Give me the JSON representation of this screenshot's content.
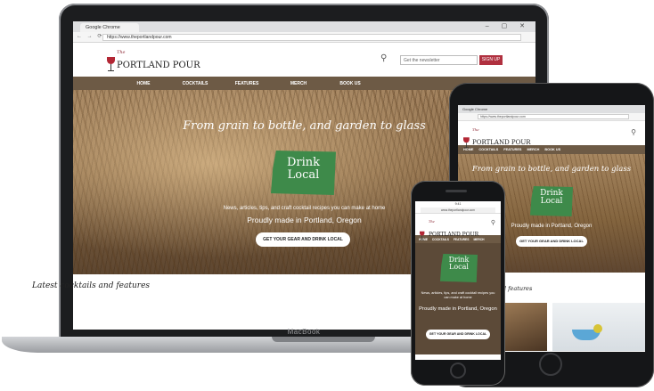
{
  "device_label": "MacBook",
  "browser": {
    "tab_title": "Google Chrome",
    "url": "https://www.theportlandpour.com",
    "window_controls": "– ▢ ✕",
    "nav_arrows": "← → ⟳"
  },
  "tablet_browser": {
    "tab_title": "Google Chrome",
    "url": "https://www.theportlandpour.com"
  },
  "phone_browser": {
    "status_time": "9:41",
    "url": "www.theportlandpour.com"
  },
  "site": {
    "logo_the": "The",
    "logo_name": "PORTLAND POUR",
    "search_icon": "⚲",
    "newsletter_placeholder": "Get the newsletter",
    "signup_label": "SIGN UP",
    "nav": [
      "HOME",
      "COCKTAILS",
      "FEATURES",
      "MERCH",
      "BOOK US"
    ],
    "hero_tagline": "From grain to bottle, and garden to glass",
    "badge_line1": "Drink",
    "badge_line2": "Local",
    "hero_sub": "News, articles, tips, and craft cocktail recipes you can make at home",
    "hero_made": "Proudly made in Portland, Oregon",
    "hero_button": "GET YOUR GEAR AND DRINK LOCAL",
    "latest_heading": "Latest cocktails and features",
    "tablet_features_heading": "l features"
  },
  "colors": {
    "nav_bg": "#6d5a45",
    "signup_bg": "#b0303f",
    "badge_green": "#3e8a4a"
  }
}
